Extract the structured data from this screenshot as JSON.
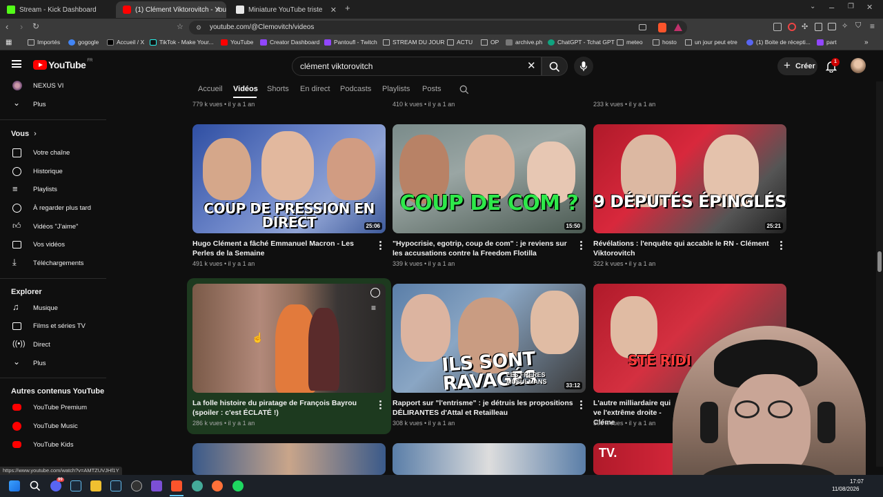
{
  "browser": {
    "tabs": [
      {
        "label": "Stream - Kick Dashboard",
        "color": "#53fc18",
        "active": false
      },
      {
        "label": "(1) Clément Viktorovitch - YouTu",
        "color": "#ff0000",
        "active": true
      },
      {
        "label": "Miniature YouTube triste",
        "color": "#e8e8e8",
        "active": false
      }
    ],
    "url": "youtube.com/@Clemovitch/videos",
    "bookmarks": [
      "Importés",
      "gogogle",
      "Accueil / X",
      "TikTok - Make Your...",
      "YouTube",
      "Creator Dashboard",
      "Pantoufl - Twitch",
      "STREAM DU JOUR",
      "ACTU",
      "OP",
      "archive.ph",
      "ChatGPT - Tchat GPT",
      "meteo",
      "hosto",
      "un jour peut etre",
      "(1) Boite de récepti...",
      "part"
    ],
    "status_url": "https://www.youtube.com/watch?v=AMTZUVJHf1Y"
  },
  "youtube": {
    "logo": "YouTube",
    "logo_region": "FR",
    "search_value": "clément viktorovitch",
    "create_label": "Créer",
    "notif_count": "1"
  },
  "sidebar": {
    "top_items": [
      {
        "label": "NEXUS VI",
        "icon": "channel-avatar-icon"
      },
      {
        "label": "Plus",
        "icon": "chevron-down-icon"
      }
    ],
    "vous_label": "Vous",
    "vous_items": [
      {
        "label": "Votre chaîne",
        "icon": "channel-icon"
      },
      {
        "label": "Historique",
        "icon": "history-icon"
      },
      {
        "label": "Playlists",
        "icon": "playlist-icon"
      },
      {
        "label": "À regarder plus tard",
        "icon": "clock-icon"
      },
      {
        "label": "Vidéos \"J'aime\"",
        "icon": "like-icon"
      },
      {
        "label": "Vos vidéos",
        "icon": "video-icon"
      },
      {
        "label": "Téléchargements",
        "icon": "download-icon"
      }
    ],
    "explorer_label": "Explorer",
    "explorer_items": [
      {
        "label": "Musique",
        "icon": "music-icon"
      },
      {
        "label": "Films et séries TV",
        "icon": "film-icon"
      },
      {
        "label": "Direct",
        "icon": "live-icon"
      },
      {
        "label": "Plus",
        "icon": "chevron-down-icon"
      }
    ],
    "other_label": "Autres contenus YouTube",
    "other_items": [
      {
        "label": "YouTube Premium",
        "icon": "youtube-premium-icon"
      },
      {
        "label": "YouTube Music",
        "icon": "youtube-music-icon"
      },
      {
        "label": "YouTube Kids",
        "icon": "youtube-kids-icon"
      }
    ]
  },
  "channel_tabs": [
    "Accueil",
    "Vidéos",
    "Shorts",
    "En direct",
    "Podcasts",
    "Playlists",
    "Posts"
  ],
  "top_meta": [
    "779 k vues • il y a 1 an",
    "410 k vues • il y a 1 an",
    "233 k vues • il y a 1 an"
  ],
  "videos": [
    {
      "title": "Hugo Clément a fâché Emmanuel Macron - Les Perles de la Semaine",
      "meta": "491 k vues • il y a 1 an",
      "duration": "25:06",
      "overlay": "COUP DE PRESSION EN DIRECT"
    },
    {
      "title": "\"Hypocrisie, egotrip, coup de com\" : je reviens sur les accusations contre la Freedom Flotilla",
      "meta": "339 k vues • il y a 1 an",
      "duration": "15:50",
      "overlay": "COUP DE COM ?"
    },
    {
      "title": "Révélations : l'enquête qui accable le RN - Clément Viktorovitch",
      "meta": "322 k vues • il y a 1 an",
      "duration": "25:21",
      "overlay": "9 DÉPUTÉS ÉPINGLÉS"
    },
    {
      "title": "La folle histoire du piratage de François Bayrou (spoiler : c'est ÉCLATÉ !)",
      "meta": "286 k vues • il y a 1 an",
      "duration": "",
      "overlay": ""
    },
    {
      "title": "Rapport sur \"l'entrisme\" : je détruis les propositions DÉLIRANTES d'Attal et Retailleau",
      "meta": "308 k vues • il y a 1 an",
      "duration": "33:12",
      "overlay": "ILS SONT RAVAGÉS",
      "overlay2": "LES FRÈRES MUSULMANS"
    },
    {
      "title": "L'autre milliardaire qui ve l'extrême droite - Cléme",
      "meta": "500 k vues • il y a 1 an",
      "duration": "",
      "overlay": "STE RIDI"
    }
  ],
  "taskbar": {
    "time": "17:07",
    "date": "11/08/2026",
    "discord_badge": "99"
  },
  "colors": {
    "accent": "#ff0000",
    "hover_card": "#1f3a1f",
    "bg": "#0f0f0f"
  }
}
